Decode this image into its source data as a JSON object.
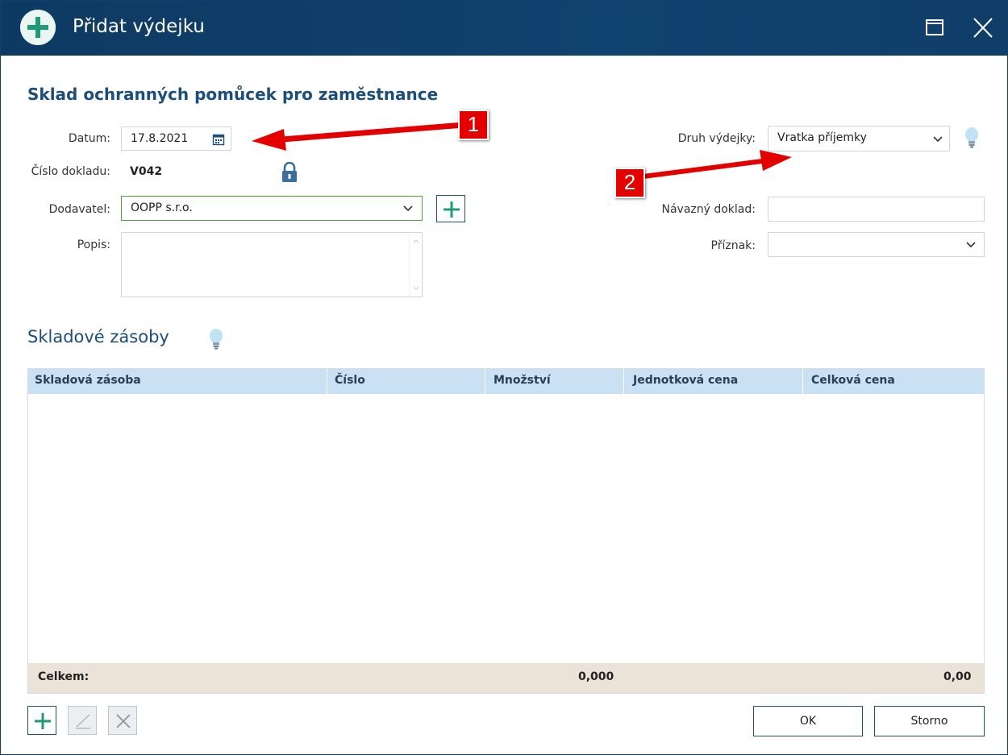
{
  "window": {
    "title": "Přidat výdejku",
    "maximize_icon": "maximize-icon",
    "close_icon": "close-icon"
  },
  "form": {
    "heading": "Sklad ochranných pomůcek pro zaměstnance",
    "datum_label": "Datum:",
    "datum_value": "17.8.2021",
    "cislo_label": "Číslo dokladu:",
    "cislo_value": "V042",
    "dodavatel_label": "Dodavatel:",
    "dodavatel_value": "OOPP s.r.o.",
    "popis_label": "Popis:",
    "popis_value": "",
    "druh_label": "Druh výdejky:",
    "druh_value": "Vratka příjemky",
    "navazny_label": "Návazný doklad:",
    "navazny_value": "",
    "priznak_label": "Příznak:",
    "priznak_value": ""
  },
  "stock": {
    "section_title": "Skladové zásoby",
    "columns": [
      "Skladová zásoba",
      "Číslo",
      "Množství",
      "Jednotková cena",
      "Celková cena"
    ],
    "rows": [],
    "footer_label": "Celkem:",
    "total_quantity": "0,000",
    "total_price": "0,00"
  },
  "buttons": {
    "ok": "OK",
    "cancel": "Storno"
  },
  "annotations": {
    "badge1": "1",
    "badge2": "2"
  },
  "colors": {
    "titlebar": "#0f3e69",
    "accent_green": "#1f9a74",
    "heading_blue": "#1c4e7a",
    "grid_header": "#c9e1f2",
    "grid_footer": "#ece3d8",
    "annotation_red": "#e50000"
  }
}
